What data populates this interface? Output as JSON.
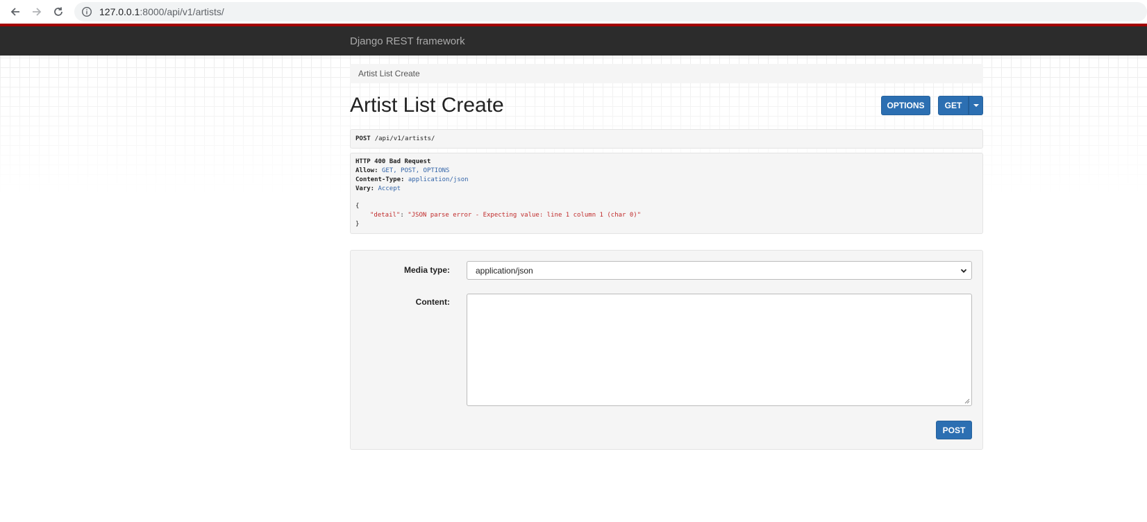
{
  "browser": {
    "url_host": "127.0.0.1",
    "url_path": ":8000/api/v1/artists/"
  },
  "navbar": {
    "brand": "Django REST framework"
  },
  "breadcrumb": {
    "current": "Artist List Create"
  },
  "page": {
    "title": "Artist List Create",
    "options_label": "OPTIONS",
    "get_label": "GET"
  },
  "request": {
    "method": "POST",
    "path": "/api/v1/artists/"
  },
  "response": {
    "status": "HTTP 400 Bad Request",
    "allow_key": "Allow:",
    "allow_value": "GET, POST, OPTIONS",
    "ctype_key": "Content-Type:",
    "ctype_value": "application/json",
    "vary_key": "Vary:",
    "vary_value": "Accept",
    "open_brace": "{",
    "detail_key": "\"detail\"",
    "detail_colon": ": ",
    "detail_value": "\"JSON parse error - Expecting value: line 1 column 1 (char 0)\"",
    "close_brace": "}"
  },
  "form": {
    "media_type_label": "Media type:",
    "media_type_value": "application/json",
    "content_label": "Content:",
    "content_value": "",
    "post_label": "POST"
  },
  "colors": {
    "navbar_bg": "#2c2c2c",
    "navbar_accent": "#a30000",
    "button_blue": "#2c6fb2"
  }
}
